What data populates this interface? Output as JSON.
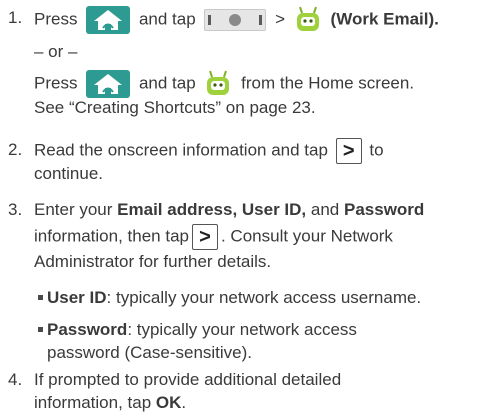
{
  "steps": {
    "step1": {
      "num": "1.",
      "press": "Press",
      "and_tap": "and tap",
      "gt": ">",
      "work_email": "(Work Email).",
      "or": "– or –",
      "press2": "Press",
      "and_tap2": "and tap",
      "from_home": "from the Home screen.",
      "see": "See “Creating Shortcuts” on page 23."
    },
    "step2": {
      "num": "2.",
      "line1": "Read the onscreen information and tap",
      "to": "to",
      "line2": "continue."
    },
    "step3": {
      "num": "3.",
      "enter": "Enter your",
      "fields": "Email address, User ID,",
      "and": "and",
      "password": "Password",
      "information": "information, then tap",
      "consult": ". Consult your Network",
      "admin": "Administrator for further details.",
      "userid_label": "User ID",
      "userid_text": ": typically your network access username.",
      "password_label": "Password",
      "password_text": ": typically your network access",
      "password_text2": "password (Case-sensitive)."
    },
    "step4": {
      "num": "4.",
      "line1": "If prompted to provide additional detailed",
      "line2": "information, tap",
      "ok": "OK",
      "period": "."
    }
  },
  "icons": {
    "home_button_color": "#2e9b93",
    "robot_color": "#9ed13c",
    "arrow_glyph": ">"
  }
}
